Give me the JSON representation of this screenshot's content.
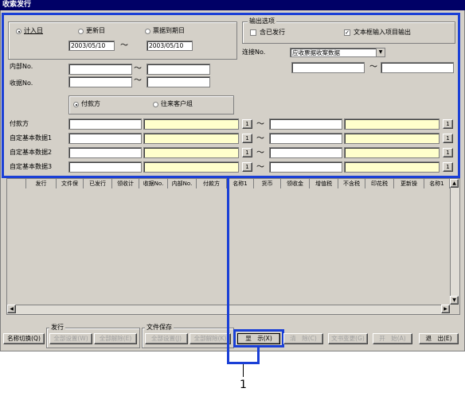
{
  "window": {
    "title": "收索发行"
  },
  "date_mode": {
    "options": [
      "计入日",
      "更新日",
      "票据到期日"
    ],
    "from": "2003/05/10",
    "tilde": "～",
    "to": "2003/05/10"
  },
  "output": {
    "title": "输出选项",
    "include_issued": "含已发行",
    "text_frame": "文本框输入项目输出"
  },
  "connect": {
    "label": "连接No.",
    "selected": "应收票据收案数据"
  },
  "fields": {
    "internal_no": "内部No.",
    "receipt_no": "收据No."
  },
  "party": {
    "payer": "付款方",
    "client_group": "往来客户组"
  },
  "ranges": [
    {
      "label": "付款方",
      "btn": "1",
      "tilde": "～"
    },
    {
      "label": "自定基本数据1",
      "btn": "1",
      "tilde": "～"
    },
    {
      "label": "自定基本数据2",
      "btn": "1",
      "tilde": "～"
    },
    {
      "label": "自定基本数据3",
      "btn": "1",
      "tilde": "～"
    }
  ],
  "grid": {
    "columns": [
      "发行",
      "文件保",
      "已发行",
      "领收计",
      "收据No.",
      "内部No.",
      "付款方",
      "名称1",
      "货币",
      "领收金",
      "增值税",
      "不含税",
      "印花税",
      "更新操",
      "名称1"
    ]
  },
  "bottom": {
    "issue_group": "发行",
    "save_group": "文件保存",
    "name_switch": "名称切换(Q)",
    "set_all1": "全部设置(W)",
    "release_all1": "全部解除(E)",
    "set_all2": "全部设置(J)",
    "release_all2": "全部解除(K)",
    "show": "显　示(X)",
    "clear": "清　除(C)",
    "text_change": "文书变更(G)",
    "open": "开　始(A)",
    "exit": "退　出(E)"
  },
  "callout": {
    "number": "1"
  },
  "colors": {
    "highlight": "#1a3fd6",
    "title_bar": "#000066",
    "yellow_input": "#ffffcc"
  }
}
